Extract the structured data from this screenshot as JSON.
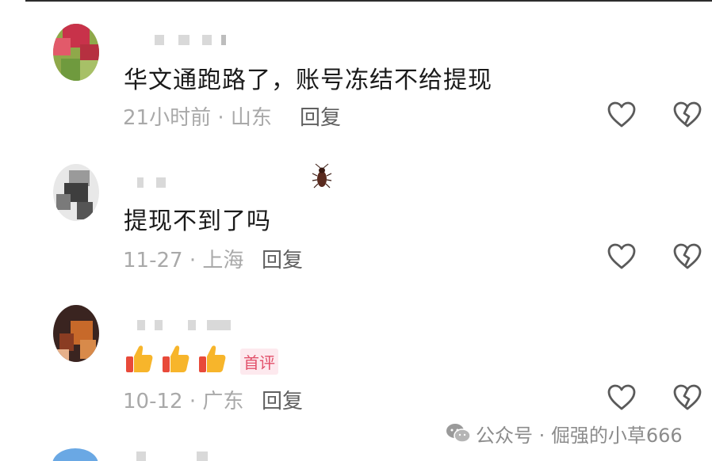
{
  "comments": [
    {
      "text": "华文通跑路了，账号冻结不给提现",
      "meta": "21小时前 · 山东",
      "reply_label": "回复"
    },
    {
      "text": "提现不到了吗",
      "meta": "11-27 · 上海",
      "reply_label": "回复"
    },
    {
      "text": "",
      "meta": "10-12 · 广东",
      "reply_label": "回复",
      "badge": "首评",
      "emoji_icons": [
        "thumbs-up-icon",
        "thumbs-up-icon",
        "thumbs-up-icon"
      ]
    }
  ],
  "icons": {
    "like": "heart-icon",
    "dislike": "broken-heart-icon",
    "watermark": "wechat-icon",
    "bug": "cockroach-icon"
  },
  "watermark": {
    "text": "公众号 · 倔强的小草666"
  },
  "colors": {
    "text": "#1a1a1a",
    "meta": "#a9a9a9",
    "reply": "#606060",
    "icon": "#5a5a5a",
    "badge": "#e2506a"
  }
}
